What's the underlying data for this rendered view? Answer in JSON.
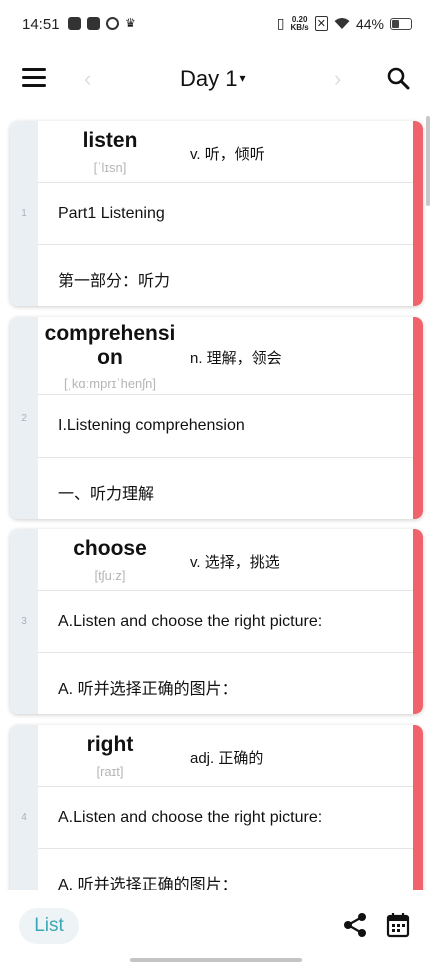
{
  "status_bar": {
    "time": "14:51",
    "speed_top": "0.20",
    "speed_unit": "KB/s",
    "battery": "44%",
    "battery_level": 0.44
  },
  "header": {
    "title": "Day 1",
    "caret": "▾"
  },
  "words": [
    {
      "index": "1",
      "word": "listen",
      "phonetic": "[ˈlɪsn]",
      "meaning": "v. 听，倾听",
      "example_en": "Part1 Listening",
      "example_zh": "第一部分：听力"
    },
    {
      "index": "2",
      "word": "comprehension",
      "word_line1": "comprehensi",
      "word_line2": "on",
      "phonetic": "[ˌkɑːmprɪˈhenʃn]",
      "meaning": "n. 理解，领会",
      "example_en": "I.Listening comprehension",
      "example_zh": "一、听力理解"
    },
    {
      "index": "3",
      "word": "choose",
      "phonetic": "[tʃuːz]",
      "meaning": "v. 选择，挑选",
      "example_en": "A.Listen and choose the right picture:",
      "example_zh": "A. 听并选择正确的图片："
    },
    {
      "index": "4",
      "word": "right",
      "phonetic": "[raɪt]",
      "meaning": "adj. 正确的",
      "example_en": "A.Listen and choose the right picture:",
      "example_zh": "A. 听并选择正确的图片："
    }
  ],
  "footer": {
    "list_label": "List"
  },
  "colors": {
    "accent_red": "#f0636b",
    "teal": "#3aa8b8",
    "index_bg": "#e9eff2"
  }
}
